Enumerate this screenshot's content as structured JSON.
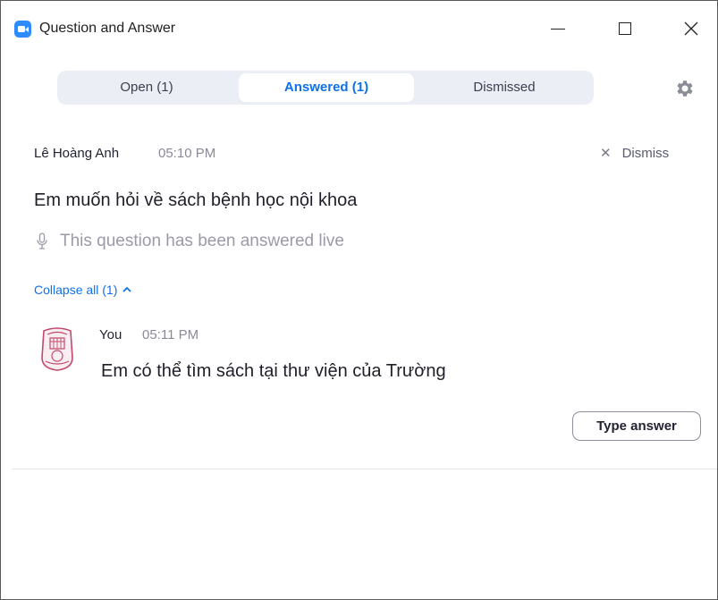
{
  "window": {
    "title": "Question and Answer",
    "accent_color": "#0e71eb",
    "logo_color": "#2d8cff",
    "controls": {
      "minimize": "minimize-icon",
      "maximize": "maximize-icon",
      "close": "close-icon"
    }
  },
  "tabs": [
    {
      "label": "Open (1)",
      "active": false
    },
    {
      "label": "Answered (1)",
      "active": true
    },
    {
      "label": "Dismissed",
      "active": false
    }
  ],
  "settings_icon": "gear-icon",
  "question": {
    "author": "Lê Hoàng Anh",
    "time": "05:10 PM",
    "dismiss_label": "Dismiss",
    "text": "Em muốn hỏi về sách bệnh học nội khoa",
    "status": "This question has been answered live",
    "status_icon": "microphone-icon",
    "collapse_label": "Collapse all (1)"
  },
  "answer": {
    "author": "You",
    "time": "05:11 PM",
    "text": "Em có thể tìm sách tại thư viện của Trường",
    "avatar_icon": "school-logo-icon"
  },
  "type_answer_label": "Type answer"
}
